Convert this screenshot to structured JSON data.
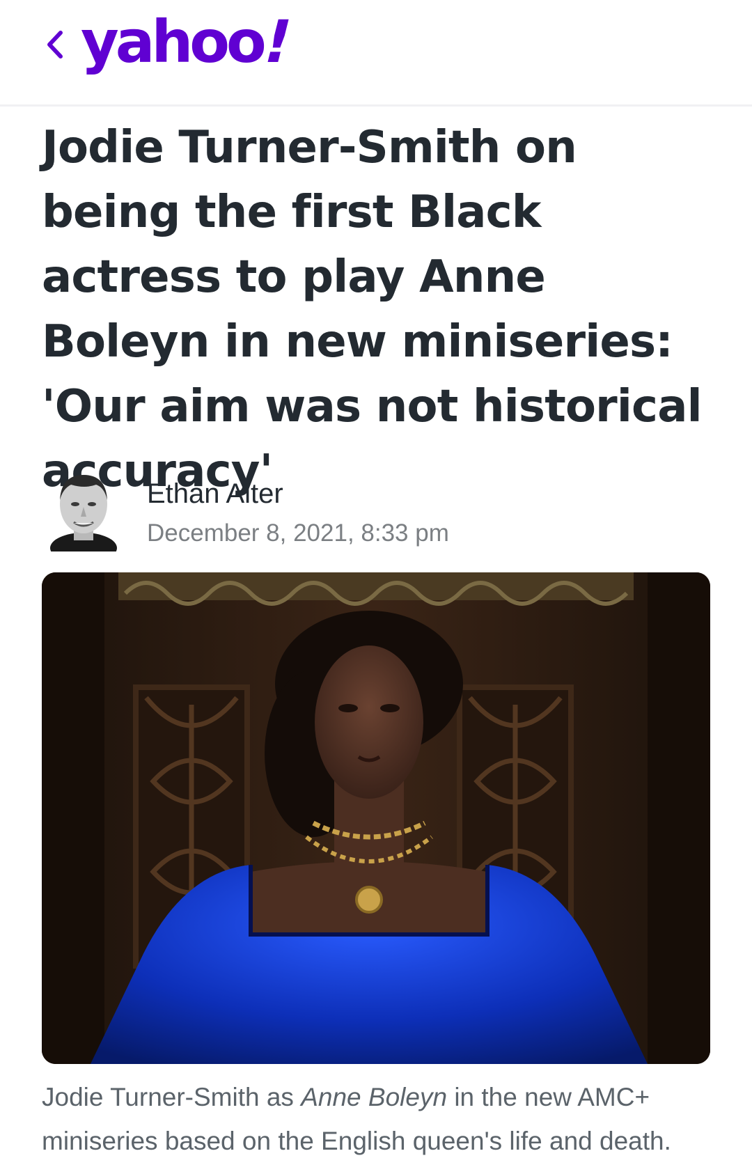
{
  "header": {
    "back_icon": "chevron-left-icon",
    "logo_text": "yahoo",
    "logo_bang": "!",
    "brand_color": "#6001d2"
  },
  "article": {
    "headline": "Jodie Turner-Smith on being the first Black actress to play Anne Boleyn in new miniseries: 'Our aim was not historical accuracy'",
    "author": {
      "name": "Ethan Alter",
      "date": "December 8, 2021, 8:33 pm"
    },
    "caption": {
      "part1": "Jodie Turner-Smith as ",
      "italic": "Anne Boleyn",
      "part2": " in the new AMC+ miniseries based on the English queen's life and death."
    }
  },
  "colors": {
    "headline": "#232a31",
    "meta": "#7b7f83",
    "caption": "#5b636a"
  }
}
